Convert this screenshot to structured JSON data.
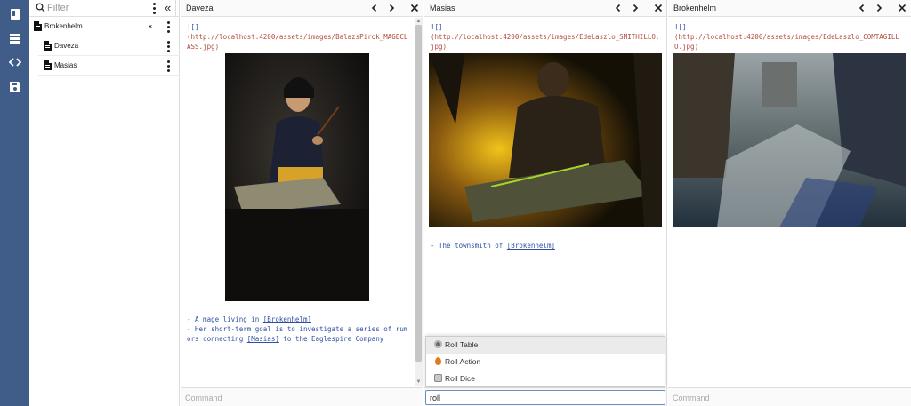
{
  "sidebar": {
    "filter_placeholder": "Filter",
    "tree": [
      {
        "label": "Brokenhelm",
        "expanded": true
      },
      {
        "label": "Daveza"
      },
      {
        "label": "Masias"
      }
    ]
  },
  "rail": {
    "icons": [
      "book-icon",
      "list-icon",
      "code-icon",
      "save-icon"
    ]
  },
  "panes": [
    {
      "title": "Daveza",
      "link_prefix": "![]",
      "url": "(http://localhost:4200/assets/images/BalazsPirok_MAGECLASS.jpg)",
      "lines": [
        {
          "before": "- A mage living in ",
          "link": "[Brokenhelm]",
          "after": ""
        },
        {
          "before": "- Her short-term goal is to investigate a series of rumors connecting ",
          "link": "[Masias]",
          "after": " to the Eaglespire Company"
        }
      ],
      "command_placeholder": "Command"
    },
    {
      "title": "Masias",
      "link_prefix": "![]",
      "url": "(http://localhost:4200/assets/images/EdeLaszlo_SMITHILLO.jpg)",
      "lines": [
        {
          "before": "- The townsmith of ",
          "link": "[Brokenhelm]",
          "after": ""
        }
      ],
      "command_value": "roll"
    },
    {
      "title": "Brokenhelm",
      "link_prefix": "![]",
      "url": "(http://localhost:4200/assets/images/EdeLaszlo_COMTAGILLO.jpg)",
      "lines": [],
      "command_placeholder": "Command"
    }
  ],
  "popup": {
    "items": [
      {
        "label": "Roll Table",
        "icon": "table-roll-icon",
        "color": "#6b6b6b"
      },
      {
        "label": "Roll Action",
        "icon": "flame-icon",
        "color": "#e07b1a"
      },
      {
        "label": "Roll Dice",
        "icon": "dice-icon",
        "color": "#9a9a9a"
      }
    ]
  },
  "colors": {
    "rail": "#3f5d88",
    "markdown_text": "#2f4fa3",
    "markdown_url": "#b34a3a"
  }
}
